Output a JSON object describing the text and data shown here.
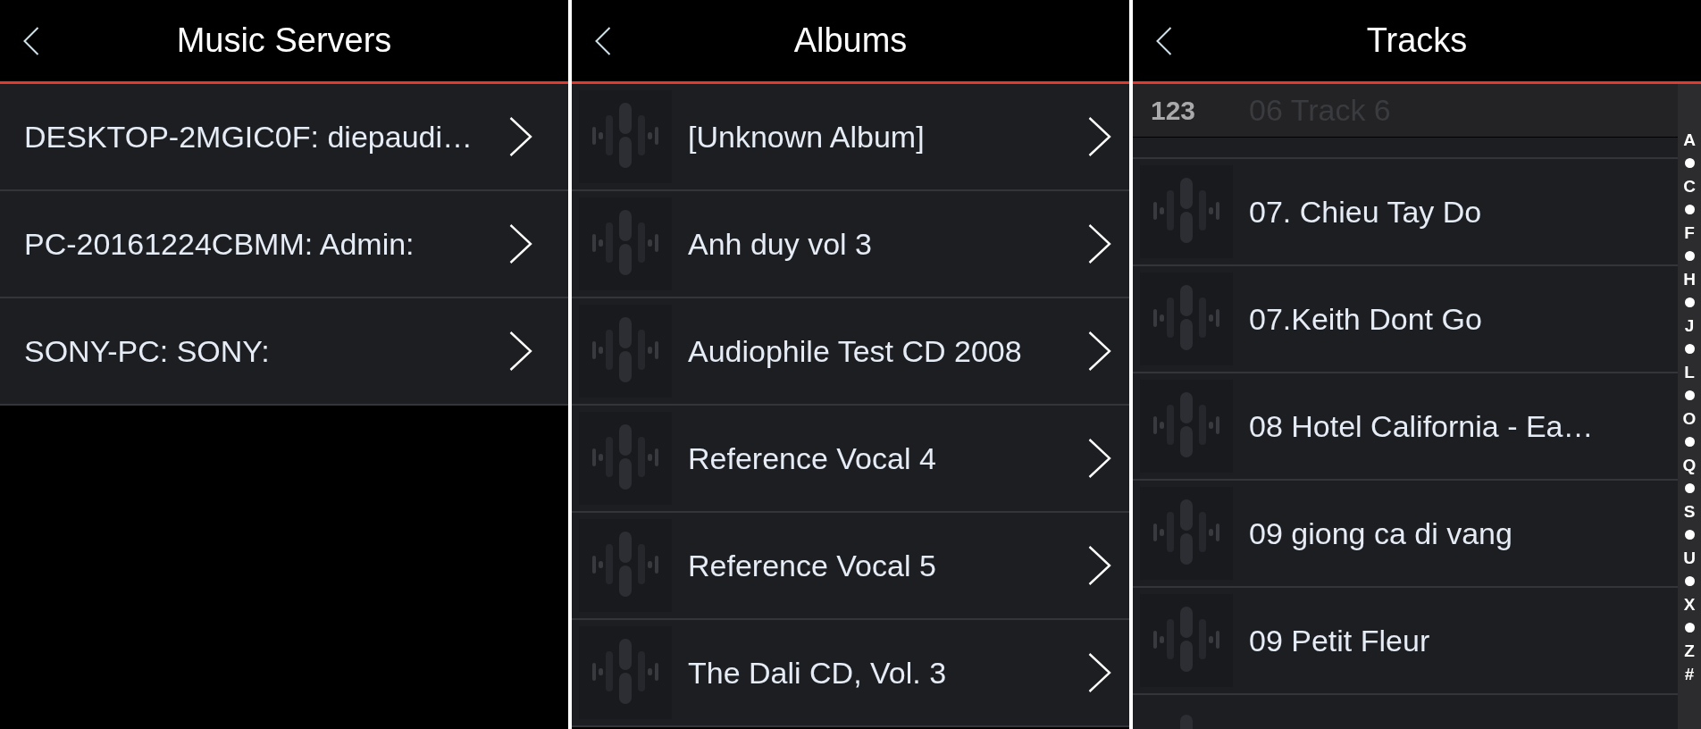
{
  "panels": [
    {
      "title": "Music Servers",
      "chevrons": true,
      "items": [
        {
          "label": "DESKTOP-2MGIC0F: diepaudi…"
        },
        {
          "label": "PC-20161224CBMM: Admin:"
        },
        {
          "label": "SONY-PC: SONY:"
        }
      ]
    },
    {
      "title": "Albums",
      "thumbnails": true,
      "chevrons": true,
      "items": [
        {
          "label": "[Unknown Album]"
        },
        {
          "label": "Anh duy vol 3"
        },
        {
          "label": "Audiophile Test CD 2008"
        },
        {
          "label": "Reference Vocal 4"
        },
        {
          "label": "Reference Vocal 5"
        },
        {
          "label": "The Dali CD, Vol. 3"
        }
      ]
    },
    {
      "title": "Tracks",
      "thumbnails": true,
      "section_header": {
        "label": "123"
      },
      "items": [
        {
          "label": "06 Track 6",
          "covered": true
        },
        {
          "label": "07. Chieu Tay Do"
        },
        {
          "label": "07.Keith Dont Go"
        },
        {
          "label": "08 Hotel California - Ea…"
        },
        {
          "label": "09 giong ca di vang"
        },
        {
          "label": "09 Petit Fleur"
        }
      ],
      "more_below": true,
      "index": [
        {
          "kind": "letter",
          "label": "A"
        },
        {
          "kind": "dot"
        },
        {
          "kind": "letter",
          "label": "C"
        },
        {
          "kind": "dot"
        },
        {
          "kind": "letter",
          "label": "F"
        },
        {
          "kind": "dot"
        },
        {
          "kind": "letter",
          "label": "H"
        },
        {
          "kind": "dot"
        },
        {
          "kind": "letter",
          "label": "J"
        },
        {
          "kind": "dot"
        },
        {
          "kind": "letter",
          "label": "L"
        },
        {
          "kind": "dot"
        },
        {
          "kind": "letter",
          "label": "O"
        },
        {
          "kind": "dot"
        },
        {
          "kind": "letter",
          "label": "Q"
        },
        {
          "kind": "dot"
        },
        {
          "kind": "letter",
          "label": "S"
        },
        {
          "kind": "dot"
        },
        {
          "kind": "letter",
          "label": "U"
        },
        {
          "kind": "dot"
        },
        {
          "kind": "letter",
          "label": "X"
        },
        {
          "kind": "dot"
        },
        {
          "kind": "letter",
          "label": "Z"
        },
        {
          "kind": "letter",
          "label": "#"
        }
      ]
    }
  ]
}
